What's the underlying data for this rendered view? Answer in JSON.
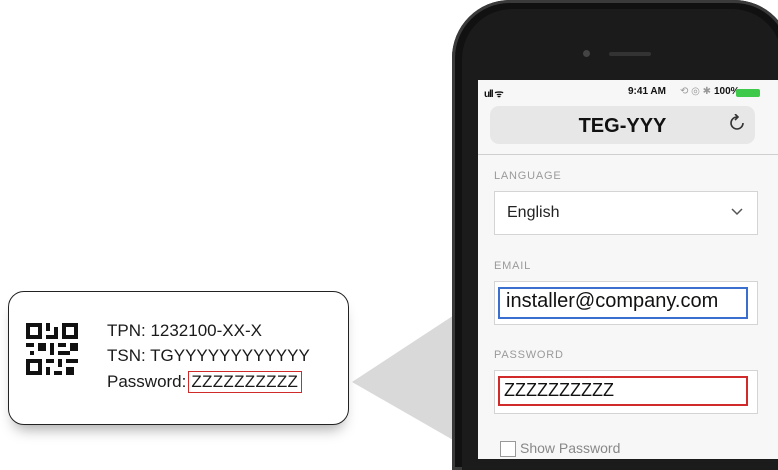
{
  "label_card": {
    "tpn": "TPN: 1232100-XX-X",
    "tsn": "TSN: TGYYYYYYYYYYYY",
    "password_prefix": "Password:",
    "password_value": "ZZZZZZZZZZ"
  },
  "status_bar": {
    "signal": "ull ᯤ",
    "time": "9:41 AM",
    "icons": "⟲ ◎ ✱",
    "battery_pct": "100%",
    "battery_color": "#3ec94a"
  },
  "browser": {
    "title": "TEG-YYY",
    "reload_icon": "reload-icon"
  },
  "form": {
    "language_label": "LANGUAGE",
    "language_value": "English",
    "email_label": "EMAIL",
    "email_value": "installer@company.com",
    "password_label": "PASSWORD",
    "password_value": "ZZZZZZZZZZ",
    "show_password_label": "Show Password"
  },
  "colors": {
    "highlight_blue": "#3b6fcf",
    "highlight_red": "#d02a2a"
  }
}
